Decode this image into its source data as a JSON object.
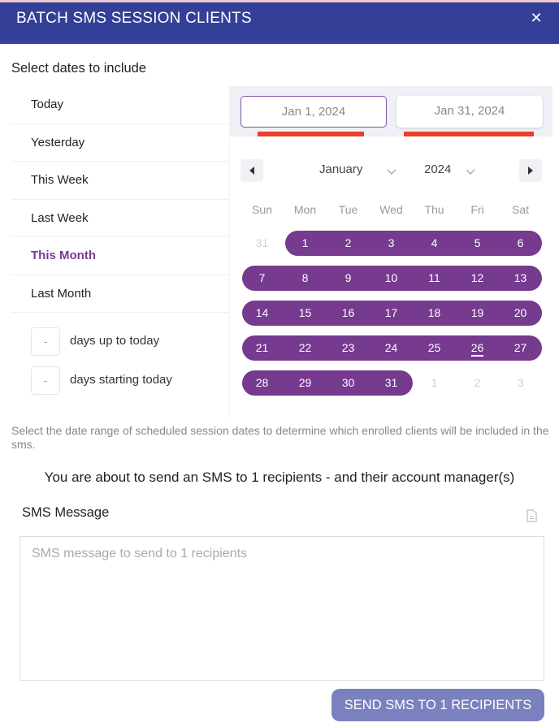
{
  "header": {
    "title": "BATCH SMS SESSION CLIENTS",
    "close_label": "✕"
  },
  "select_label": "Select dates to include",
  "presets": [
    {
      "label": "Today",
      "active": false
    },
    {
      "label": "Yesterday",
      "active": false
    },
    {
      "label": "This Week",
      "active": false
    },
    {
      "label": "Last Week",
      "active": false
    },
    {
      "label": "This Month",
      "active": true
    },
    {
      "label": "Last Month",
      "active": false
    }
  ],
  "relative_days": [
    {
      "value": "-",
      "label": "days up to today"
    },
    {
      "value": "-",
      "label": "days starting today"
    }
  ],
  "date_range": {
    "start": "Jan 1, 2024",
    "end": "Jan 31, 2024"
  },
  "calendar": {
    "month": "January",
    "year": "2024",
    "weekdays": [
      "Sun",
      "Mon",
      "Tue",
      "Wed",
      "Thu",
      "Fri",
      "Sat"
    ],
    "weeks": [
      [
        "31",
        "1",
        "2",
        "3",
        "4",
        "5",
        "6"
      ],
      [
        "7",
        "8",
        "9",
        "10",
        "11",
        "12",
        "13"
      ],
      [
        "14",
        "15",
        "16",
        "17",
        "18",
        "19",
        "20"
      ],
      [
        "21",
        "22",
        "23",
        "24",
        "25",
        "26",
        "27"
      ],
      [
        "28",
        "29",
        "30",
        "31",
        "1",
        "2",
        "3"
      ]
    ],
    "outside_month": [
      [
        0,
        0
      ],
      [
        4,
        4
      ],
      [
        4,
        5
      ],
      [
        4,
        6
      ]
    ],
    "today": "26",
    "selected_range": [
      "1",
      "31"
    ],
    "accent_color": "#763a8f"
  },
  "hint": "Select the date range of scheduled session dates to determine which enrolled clients will be included in the sms.",
  "notice": "You are about to send an SMS to 1 recipients - and their account manager(s)",
  "sms": {
    "label": "SMS Message",
    "placeholder": "SMS message to send to 1 recipients",
    "value": ""
  },
  "send_button": "SEND SMS TO 1 RECIPIENTS",
  "colors": {
    "header": "#343f97",
    "accent": "#763a8f",
    "button": "#7b80bf",
    "range_marker": "#e8402a"
  }
}
